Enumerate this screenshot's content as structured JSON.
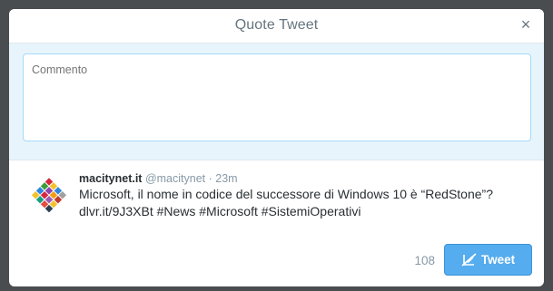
{
  "dialog": {
    "title": "Quote Tweet",
    "close_glyph": "×",
    "close_icon": "close-icon"
  },
  "compose": {
    "placeholder": "Commento",
    "value": ""
  },
  "quoted_tweet": {
    "avatar_icon": "macitynet-logo",
    "name": "macitynet.it",
    "handle": "@macitynet",
    "separator": "·",
    "time": "23m",
    "text_line1": "Microsoft, il nome in codice del successore di Windows 10 è “RedStone”?",
    "text_line2": "dlvr.it/9J3XBt #News #Microsoft #SistemiOperativi"
  },
  "footer": {
    "char_count": "108",
    "tweet_label": "Tweet",
    "tweet_icon": "compose-quill-icon"
  },
  "colors": {
    "accent": "#55acee",
    "compose_background": "#e8f4fb",
    "overlay": "#4a4d50"
  }
}
